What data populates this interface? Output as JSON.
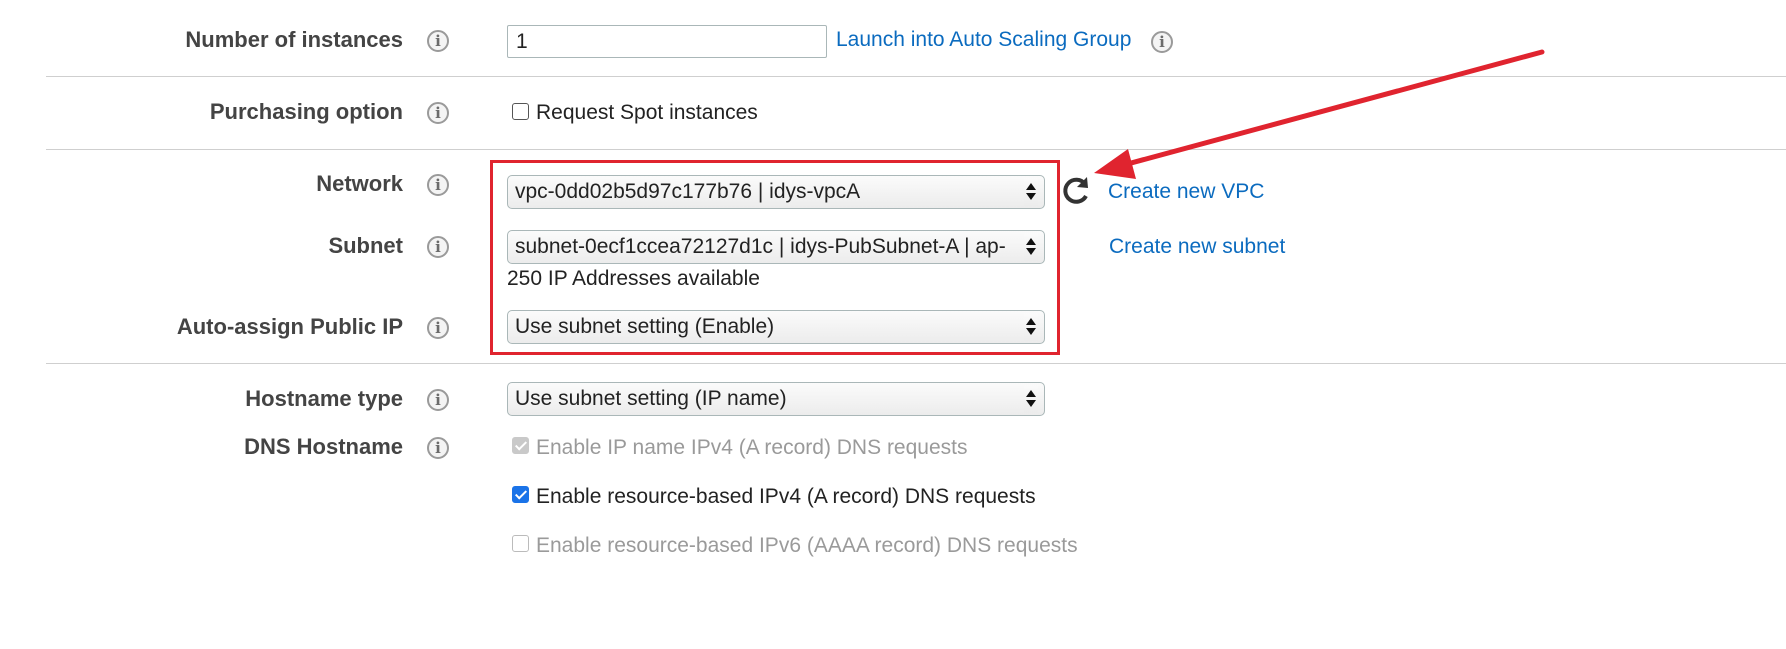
{
  "rows": {
    "instances": {
      "label": "Number of instances",
      "value": "1",
      "asg_link": "Launch into Auto Scaling Group"
    },
    "purchasing": {
      "label": "Purchasing option",
      "spot_label": "Request Spot instances",
      "spot_checked": false
    },
    "network": {
      "label": "Network",
      "selected": "vpc-0dd02b5d97c177b76 | idys-vpcA",
      "create_link": "Create new VPC"
    },
    "subnet": {
      "label": "Subnet",
      "selected": "subnet-0ecf1ccea72127d1c | idys-PubSubnet-A | ap-",
      "available": "250 IP Addresses available",
      "create_link": "Create new subnet"
    },
    "public_ip": {
      "label": "Auto-assign Public IP",
      "selected": "Use subnet setting (Enable)"
    },
    "hostname_type": {
      "label": "Hostname type",
      "selected": "Use subnet setting (IP name)"
    },
    "dns_hostname": {
      "label": "DNS Hostname",
      "options": [
        {
          "label": "Enable IP name IPv4 (A record) DNS requests",
          "checked": true,
          "disabled": true
        },
        {
          "label": "Enable resource-based IPv4 (A record) DNS requests",
          "checked": true,
          "disabled": false
        },
        {
          "label": "Enable resource-based IPv6 (AAAA record) DNS requests",
          "checked": false,
          "disabled": true
        }
      ]
    }
  },
  "colors": {
    "link": "#0b6bbf",
    "highlight": "#e0242f",
    "checkbox_checked": "#1a73e8"
  },
  "icons": [
    "info-icon",
    "refresh-icon",
    "dropdown-arrows-icon",
    "annotation-arrow"
  ]
}
